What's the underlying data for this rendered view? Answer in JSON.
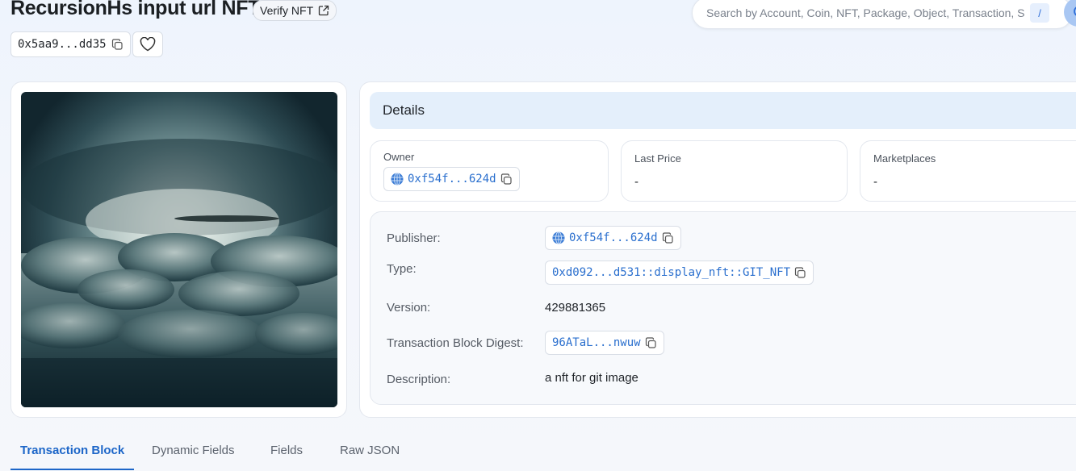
{
  "header": {
    "title": "RecursionHs input url NFT",
    "verify_label": "Verify NFT",
    "object_address": "0x5aa9...dd35"
  },
  "search": {
    "placeholder": "Search by Account, Coin, NFT, Package, Object, Transaction, S...",
    "shortcut": "/"
  },
  "details": {
    "heading": "Details",
    "owner": {
      "label": "Owner",
      "value": "0xf54f...624d"
    },
    "last_price": {
      "label": "Last Price",
      "value": "-"
    },
    "marketplaces": {
      "label": "Marketplaces",
      "value": "-"
    },
    "properties": {
      "publisher": {
        "label": "Publisher:",
        "value": "0xf54f...624d"
      },
      "type": {
        "label": "Type:",
        "value": "0xd092...d531::display_nft::GIT_NFT"
      },
      "version": {
        "label": "Version:",
        "value": "429881365"
      },
      "digest": {
        "label": "Transaction Block Digest:",
        "value": "96ATaL...nwuw"
      },
      "description": {
        "label": "Description:",
        "value": "a nft for git image"
      }
    }
  },
  "tabs": [
    {
      "label": "Transaction Block",
      "active": true
    },
    {
      "label": "Dynamic Fields",
      "active": false
    },
    {
      "label": "Fields",
      "active": false
    },
    {
      "label": "Raw JSON",
      "active": false
    }
  ],
  "colors": {
    "accent": "#1d66c8",
    "link": "#2a6fce",
    "details_header_bg": "#e4effb"
  },
  "icons": {
    "copy": "copy-icon",
    "external": "external-link-icon",
    "heart": "heart-icon",
    "search": "search-icon",
    "owner_avatar": "globe-avatar-icon"
  }
}
